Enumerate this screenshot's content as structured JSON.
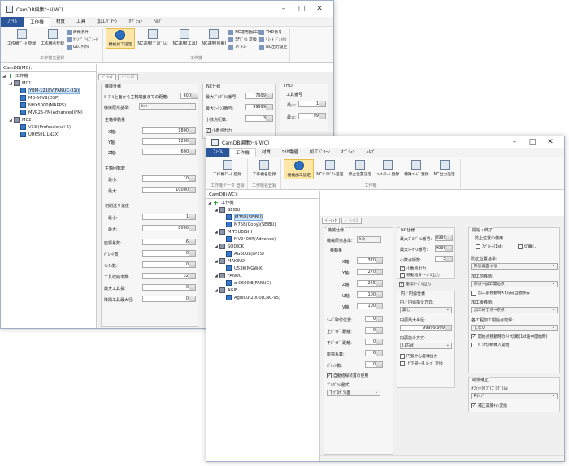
{
  "w1": {
    "title": "CamDB編集ﾂｰﾙ(MC)",
    "menu": {
      "file": "ﾌｧｲﾙ",
      "tabs": [
        "工作機",
        "材質",
        "工具",
        "加工ﾊﾟﾀｰﾝ",
        "ｵﾌﾟｼｮﾝ",
        "ﾍﾙﾌﾟ"
      ]
    },
    "ribbon": {
      "b1": "工作機ﾃﾞｰﾀ 登録",
      "b2": "工作機名登録",
      "s1": "周類条件",
      "s2": "ｸﾗﾝﾌﾟ ｻｲｽﾞｺｰﾄﾞ",
      "s3": "G01ｻｲｸﾙ",
      "g1": "工作機名登録",
      "b3": "機械加工設定",
      "b4": "NC運用[ﾌﾟﾛｸﾞﾗﾑ]",
      "b5": "NC運用[工具]",
      "b6": "NC運用[移動]",
      "s4": "NC運用[加工]",
      "s5": "SFﾄﾞﾘﾙ 変換",
      "s6": "ｽﾍﾟﾁｭｰ",
      "s7": "THD番号",
      "s8": "ﾘﾐｯﾄ ｼﾞｵﾒﾄﾘ",
      "s9": "NC出力設定",
      "g2": "工作機"
    },
    "side": {
      "title": "CamDB(MC):",
      "root": "工作機",
      "mc1": "MC1",
      "m1": "YBM-1218V(FANUC-31i)",
      "m2": "MB-56VB(OSP)",
      "m3": "NHX5000(MAPPS)",
      "m4": "MVR25-FM(Advanced)FM)",
      "mc2": "MC2",
      "m5": "V33i(Professional-6)",
      "m6": "UH650L(LN2X)"
    },
    "tabs": [
      "ﾍﾞｰｼｯｸ",
      "ﾍﾞｰｼｯｸ2"
    ],
    "f": {
      "g1": "機械仕様",
      "l1": "ﾃｰﾌﾞﾙ上面から主軸端面までの距離:",
      "v1": "600",
      "l2": "機械原点基準:",
      "v2": "ｾﾝﾀｰ",
      "g2": "主軸移動量",
      "x": "X軸:",
      "xv": "1800",
      "y": "Y軸:",
      "yv": "1200",
      "z": "Z軸:",
      "zv": "600",
      "g3": "主軸回転数",
      "mn": "最小:",
      "mnv": "10",
      "mx": "最大:",
      "mxv": "10000",
      "g4": "切削送り速度",
      "mn2": "最小:",
      "mn2v": "1",
      "mx2": "最大:",
      "mx2v": "8000",
      "l3": "座標系数:",
      "v3": "6",
      "l4": "ﾊﾟﾚｯﾄ数:",
      "v4": "0",
      "l5": "ｲﾝｸﾙ数:",
      "v5": "0",
      "l6": "工具収納本数:",
      "v6": "32",
      "l7": "最大工具長:",
      "v7": "0",
      "l8": "降隣工具最大径:",
      "v8": "0",
      "g5": "NC仕様",
      "l9": "最大ﾌﾟﾛｸﾞﾗﾑ番号:",
      "v9": "7999",
      "l10": "最大ｼｰｹﾝｽ番号:",
      "v10": "99999",
      "l11": "小数点桁数:",
      "v11": "3",
      "c1": "小数点出力",
      "g6": "THD",
      "g7": "工具番号",
      "mn3": "最小:",
      "mn3v": "1",
      "mx3": "最大:",
      "mx3v": "99"
    }
  },
  "w2": {
    "title": "CamDB編集ﾂｰﾙ(WC)",
    "menu": {
      "file": "ﾌｧｲﾙ",
      "tabs": [
        "工作機",
        "材質",
        "ﾜｲﾔ電極",
        "加工ﾊﾟﾀｰﾝ",
        "ｵﾌﾟｼｮﾝ",
        "ﾍﾙﾌﾟ"
      ]
    },
    "ribbon": {
      "b1": "工作機ﾃﾞｰﾀ 登録",
      "b2": "工作機名登録",
      "b3": "機械加工設定",
      "b4": "NCﾌﾟﾛｸﾞﾗﾑ設定",
      "b5": "停止位置設定",
      "b6": "ｺｰﾅｰﾛｰﾙ 登録",
      "b7": "特殊ｺｰﾄﾞ 登録",
      "b8": "NC出力設定",
      "g1": "工作機データ 登録",
      "g2": "工作機名登録",
      "g3": "工作機"
    },
    "side": {
      "title": "CamDB(WC):",
      "root": "工作機",
      "c1": "SEIBU",
      "m1": "M75B(SEIBU)",
      "m2": "M75B(Copy)(SEIBU)",
      "c2": "MITSUBISHI",
      "m3": "MV2400R(Advance)",
      "c3": "SODICK",
      "m4": "AG600L(LP2S)",
      "c4": "MAKINO",
      "m5": "U53K(MGW-K)",
      "c5": "FANUC",
      "m6": "α-C600iB(FANUC)",
      "c6": "AGIE",
      "m7": "AgieCut2000(CNC-v5)"
    },
    "tabs": [
      "ﾍﾞｰｼｯｸ",
      "ﾍﾞｰｼｯｸ2"
    ],
    "f": {
      "g1": "機械仕様",
      "l1": "機械原点基準:",
      "v1": "ｾﾝﾀｰ",
      "g2": "移動量",
      "x": "X軸:",
      "xv": "370",
      "y": "Y軸:",
      "yv": "270",
      "z": "Z軸:",
      "zv": "255",
      "u": "U軸:",
      "uv": "100",
      "v": "V軸:",
      "vv": "100",
      "l2": "ﾃｰﾊﾟ取付位置:",
      "v2": "0",
      "l3": "上ｶﾞｲﾄﾞ 距離:",
      "v3": "0",
      "l4": "下ｶﾞｲﾄﾞ 距離:",
      "v4": "0",
      "l5": "座標系数:",
      "v5": "6",
      "l6": "ﾊﾟﾚｯﾄ数:",
      "v6": "0",
      "c1": "自動結線装置の使用",
      "l7": "ﾌﾟﾛｸﾞﾗﾑ書式:",
      "v7": "下ﾌﾟﾛｸﾞﾗﾑ面",
      "g3": "NC仕様",
      "l8": "最大ﾌﾟﾛｸﾞﾗﾑ番号:",
      "v8": "8999",
      "l9": "最大ｼｰｹﾝｽ番号:",
      "v9": "99999",
      "l10": "小数点桁数:",
      "v10": "3",
      "c2": "小数点出力",
      "c3": "移動指令ﾃｰﾌﾞﾙ出力",
      "c4": "座標ﾃｰﾌﾞﾙ出力",
      "g4": "円／円弧仕様",
      "l11": "円／円弧指令方式:",
      "v11": "無し",
      "l12": "円弧最大半径:",
      "v12": "99999.999",
      "l13": "円弧指令方式:",
      "v13": "I,J方式",
      "c5": "円弧中心座標出力",
      "c6": "上下同一R ﾙｰﾌﾟ 変換",
      "g5": "開始・終了",
      "g6": "防止位置の使用",
      "c7": "ｱﾌﾟﾛｰﾁ(1st)",
      "c8": "切離し",
      "l14": "防止位置基準:",
      "v14": "形状端面する",
      "l15": "加工前移動:",
      "v15": "原点→加工開始点",
      "c9": "加工前移動時XY方向自動除去",
      "l16": "加工後移動:",
      "v16": "加工終了点→原点",
      "l17": "各工程加工開始点復帰:",
      "v17": "しない",
      "c10": "開始点移動時のﾜｲﾔ切断(1st途中開始時)",
      "c11": "ﾊﾞﾝｸ切断挿入開始",
      "g7": "勘係補正",
      "l18": "ｵﾌｾｯﾄﾀｲﾌﾟ(ﾌﾟﾛｸﾞﾗﾑ):",
      "v18": "Rﾀｲﾌﾟ",
      "c12": "補正実施ｷｬﾝ変換"
    }
  }
}
